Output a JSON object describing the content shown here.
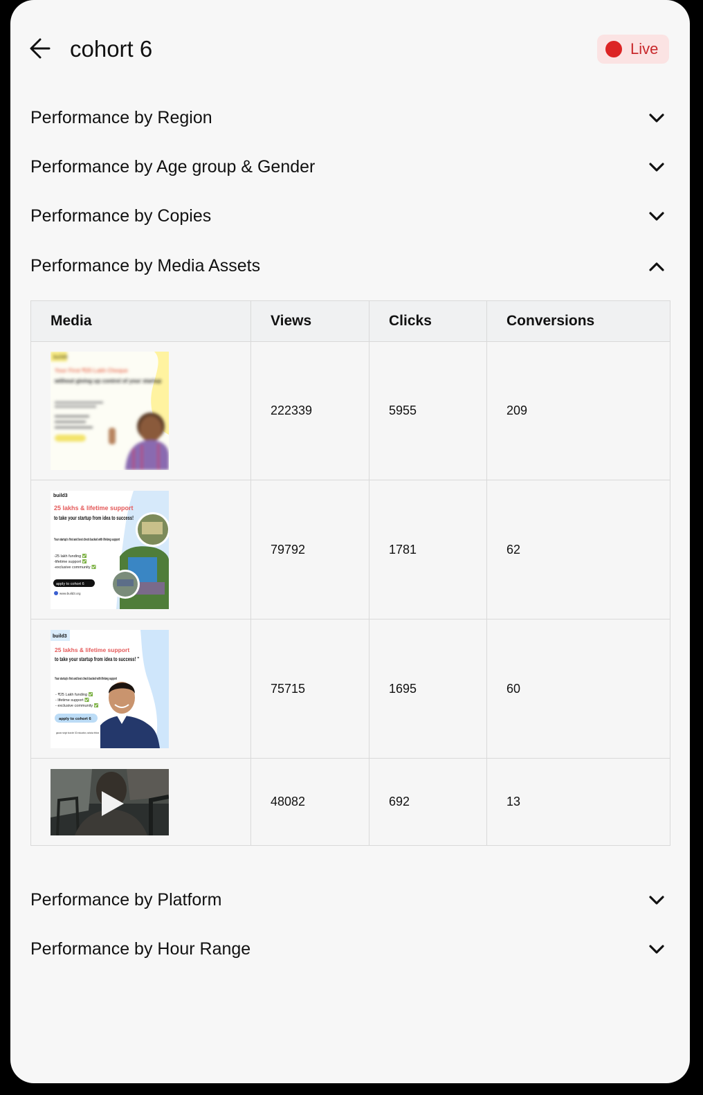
{
  "header": {
    "back_icon": "arrow-left-icon",
    "title": "cohort 6",
    "status": {
      "label": "Live",
      "color": "#dc2424"
    }
  },
  "sections": [
    {
      "label": "Performance by Region",
      "expanded": false
    },
    {
      "label": "Performance by Age group & Gender",
      "expanded": false
    },
    {
      "label": "Performance by Copies",
      "expanded": false
    },
    {
      "label": "Performance by Media Assets",
      "expanded": true
    },
    {
      "label": "Performance by Platform",
      "expanded": false
    },
    {
      "label": "Performance by Hour Range",
      "expanded": false
    }
  ],
  "media_table": {
    "columns": [
      "Media",
      "Views",
      "Clicks",
      "Conversions"
    ],
    "rows": [
      {
        "views": "222339",
        "clicks": "5955",
        "conversions": "209",
        "media": {
          "type": "image",
          "brand": "build3",
          "headline": "Your First ₹25 Lakh Cheque",
          "subheadline": "without giving up control of your startup"
        }
      },
      {
        "views": "79792",
        "clicks": "1781",
        "conversions": "62",
        "media": {
          "type": "image",
          "brand": "build3",
          "headline": "25 lakhs & lifetime support",
          "subheadline": "to take your startup from idea to success!",
          "body": "Your startup's first and best check backed with lifelong support",
          "bullets": [
            "-25 lakh funding ✅",
            "-lifetime support ✅",
            "-exclusive community ✅"
          ],
          "cta": "apply to cohort 6",
          "url": "www.build3.org"
        }
      },
      {
        "views": "75715",
        "clicks": "1695",
        "conversions": "60",
        "media": {
          "type": "image",
          "brand": "build3",
          "headline": "25 lakhs & lifetime support",
          "subheadline": "to take your startup from idea to success! \"",
          "body": "Your startup's first and best check backed with lifelong support",
          "bullets": [
            "- ₹25 Lakh funding ✅",
            "- lifetime support ✅",
            "- exclusive community ✅"
          ],
          "cta": "apply to cohort 6",
          "caption": "gaurav singh founder 3D education, ashoka fellow"
        }
      },
      {
        "views": "48082",
        "clicks": "692",
        "conversions": "13",
        "media": {
          "type": "video",
          "icon": "play-icon"
        }
      }
    ]
  }
}
